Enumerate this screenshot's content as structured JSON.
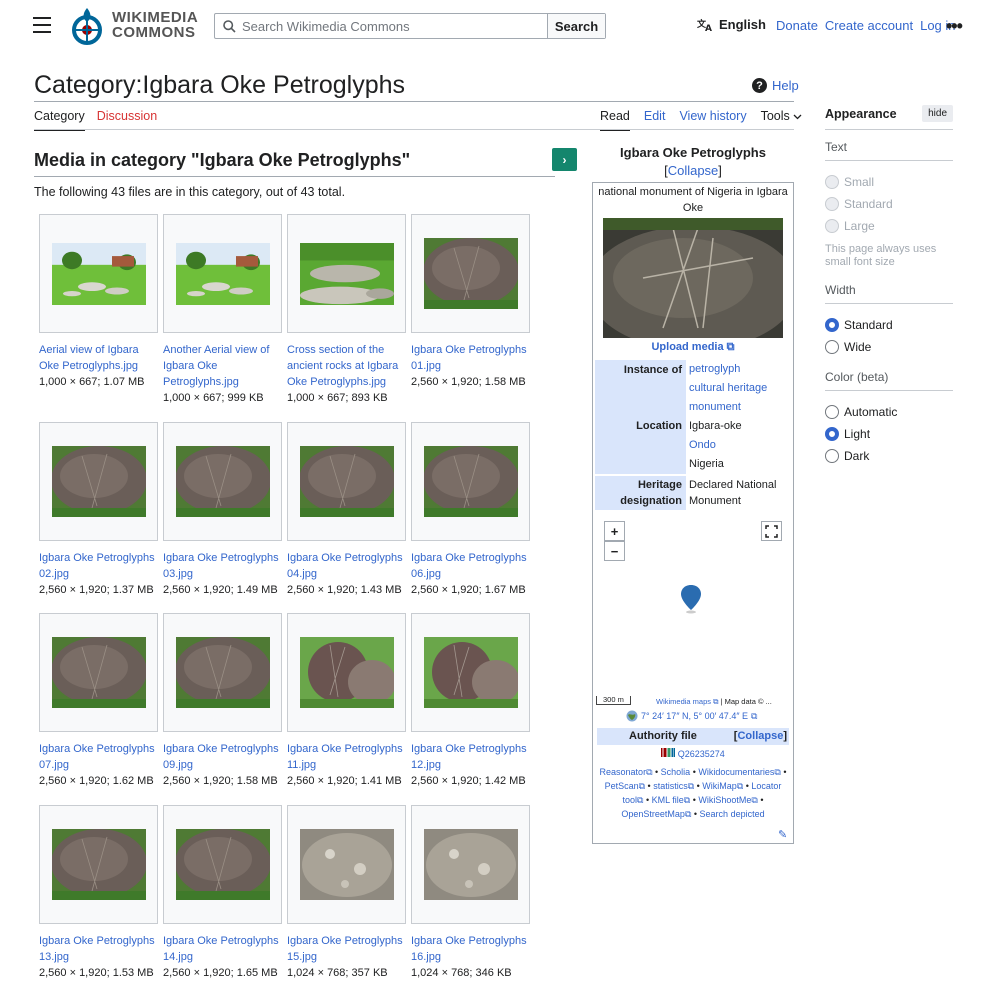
{
  "header": {
    "wordmark_line1": "WIKIMEDIA",
    "wordmark_line2": "COMMONS",
    "search_placeholder": "Search Wikimedia Commons",
    "search_button": "Search",
    "language": "English",
    "links": [
      "Donate",
      "Create account",
      "Log in"
    ],
    "more": "•••"
  },
  "page": {
    "title": "Category:Igbara Oke Petroglyphs",
    "help": "Help",
    "tabs_left": [
      "Category",
      "Discussion"
    ],
    "tabs_right": [
      "Read",
      "Edit",
      "View history",
      "Tools"
    ]
  },
  "media": {
    "heading": "Media in category \"Igbara Oke Petroglyphs\"",
    "count_text": "The following 43 files are in this category, out of 43 total.",
    "next_icon": "›",
    "items": [
      {
        "name": "Aerial view of Igbara Oke Petroglyphs.jpg",
        "meta": "1,000 × 667; 1.07 MB"
      },
      {
        "name": "Another Aerial view of Igbara Oke Petroglyphs.jpg",
        "meta": "1,000 × 667; 999 KB"
      },
      {
        "name": "Cross section of the ancient rocks at Igbara Oke Petroglyphs.jpg",
        "meta": "1,000 × 667; 893 KB"
      },
      {
        "name": "Igbara Oke Petroglyphs 01.jpg",
        "meta": "2,560 × 1,920; 1.58 MB"
      },
      {
        "name": "Igbara Oke Petroglyphs 02.jpg",
        "meta": "2,560 × 1,920; 1.37 MB"
      },
      {
        "name": "Igbara Oke Petroglyphs 03.jpg",
        "meta": "2,560 × 1,920; 1.49 MB"
      },
      {
        "name": "Igbara Oke Petroglyphs 04.jpg",
        "meta": "2,560 × 1,920; 1.43 MB"
      },
      {
        "name": "Igbara Oke Petroglyphs 06.jpg",
        "meta": "2,560 × 1,920; 1.67 MB"
      },
      {
        "name": "Igbara Oke Petroglyphs 07.jpg",
        "meta": "2,560 × 1,920; 1.62 MB"
      },
      {
        "name": "Igbara Oke Petroglyphs 09.jpg",
        "meta": "2,560 × 1,920; 1.58 MB"
      },
      {
        "name": "Igbara Oke Petroglyphs 11.jpg",
        "meta": "2,560 × 1,920; 1.41 MB"
      },
      {
        "name": "Igbara Oke Petroglyphs 12.jpg",
        "meta": "2,560 × 1,920; 1.42 MB"
      },
      {
        "name": "Igbara Oke Petroglyphs 13.jpg",
        "meta": "2,560 × 1,920; 1.53 MB"
      },
      {
        "name": "Igbara Oke Petroglyphs 14.jpg",
        "meta": "2,560 × 1,920; 1.65 MB"
      },
      {
        "name": "Igbara Oke Petroglyphs 15.jpg",
        "meta": "1,024 × 768; 357 KB"
      },
      {
        "name": "Igbara Oke Petroglyphs 16.jpg",
        "meta": "1,024 × 768; 346 KB"
      }
    ]
  },
  "infobox": {
    "title": "Igbara Oke Petroglyphs",
    "collapse": "Collapse",
    "description": "national monument of Nigeria in Igbara Oke",
    "upload": "Upload media",
    "instance_label": "Instance of",
    "instance_values": [
      "petroglyph",
      "cultural heritage monument"
    ],
    "location_label": "Location",
    "location_values": [
      "Igbara-oke",
      "Ondo",
      "Nigeria"
    ],
    "heritage_label": "Heritage designation",
    "heritage_value": "Declared National Monument",
    "map_zoom_in": "+",
    "map_zoom_out": "−",
    "map_scale": "300 m",
    "map_attr_link": "Wikimedia maps",
    "map_attr_text": "| Map data © ...",
    "coordinates": "7° 24′ 17″ N, 5° 00′ 47.4″ E",
    "authority_label": "Authority file",
    "authority_collapse": "Collapse",
    "qid": "Q26235274",
    "auth_links": [
      "Reasonator",
      "Scholia",
      "Wikidocumentaries",
      "PetScan",
      "statistics",
      "WikiMap",
      "Locator tool",
      "KML file",
      "WikiShootMe",
      "OpenStreetMap",
      "Search depicted"
    ]
  },
  "appearance": {
    "title": "Appearance",
    "hide": "hide",
    "text_label": "Text",
    "text_options": [
      "Small",
      "Standard",
      "Large"
    ],
    "text_note": "This page always uses small font size",
    "width_label": "Width",
    "width_options": [
      "Standard",
      "Wide"
    ],
    "width_selected": "Standard",
    "color_label": "Color (beta)",
    "color_options": [
      "Automatic",
      "Light",
      "Dark"
    ],
    "color_selected": "Light"
  },
  "colors": {
    "link": "#3366cc",
    "red_link": "#d73333",
    "green_button": "#14866d",
    "infobox_label_bg": "#d9e5fb"
  }
}
